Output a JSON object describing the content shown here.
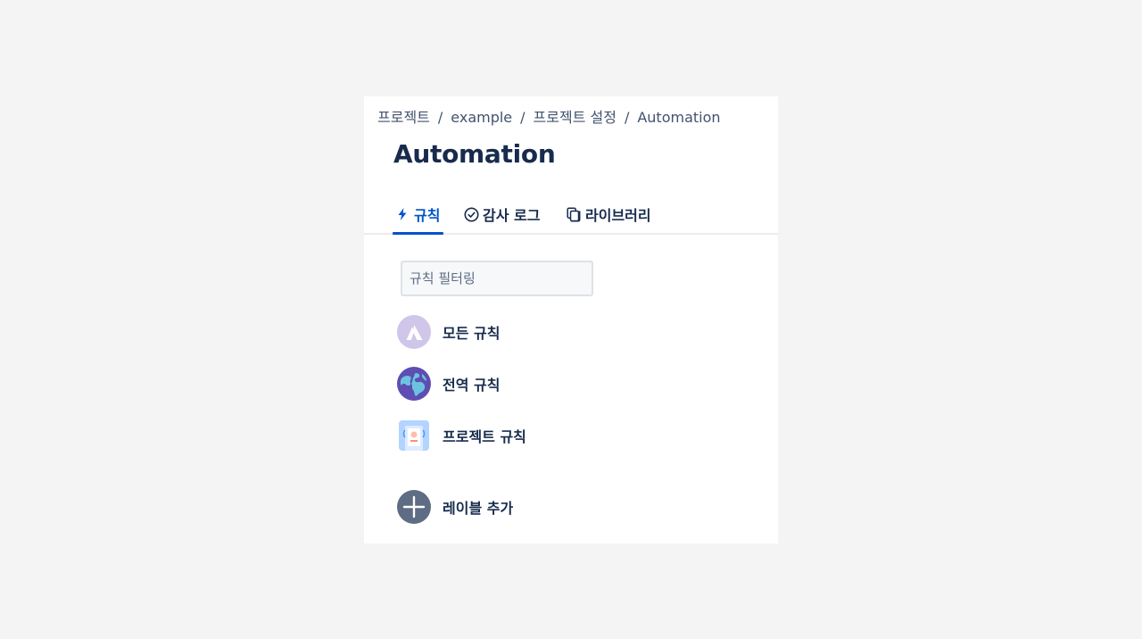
{
  "breadcrumb": {
    "items": [
      "프로젝트",
      "example",
      "프로젝트 설정",
      "Automation"
    ],
    "separator": "/"
  },
  "page": {
    "title": "Automation"
  },
  "tabs": [
    {
      "label": "규칙",
      "icon": "lightning-icon",
      "active": true
    },
    {
      "label": "감사 로그",
      "icon": "check-circle-icon",
      "active": false
    },
    {
      "label": "라이브러리",
      "icon": "copy-icon",
      "active": false
    }
  ],
  "filter": {
    "placeholder": "규칙 필터링",
    "value": ""
  },
  "rule_groups": [
    {
      "label": "모든 규칙",
      "icon": "atlassian-logo-icon"
    },
    {
      "label": "전역 규칙",
      "icon": "globe-icon"
    },
    {
      "label": "프로젝트 규칙",
      "icon": "project-avatar-icon"
    }
  ],
  "add_label": {
    "label": "레이블 추가",
    "icon": "plus-icon"
  },
  "colors": {
    "accent": "#0052cc",
    "text": "#172b4d",
    "muted": "#42526e",
    "page_background": "#f4f4f4",
    "panel_background": "#ffffff",
    "add_icon_background": "#5e6c84"
  }
}
